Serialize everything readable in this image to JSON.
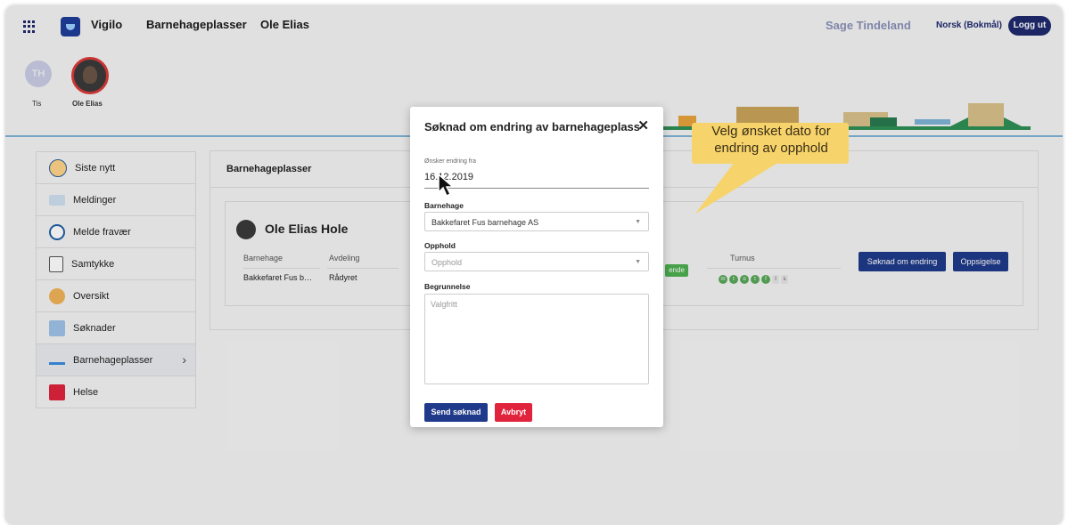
{
  "header": {
    "app_name": "Vigilo",
    "nav_items": [
      "Barnehageplasser",
      "Ole Elias"
    ],
    "user_name": "Sage Tindeland",
    "language": "Norsk (Bokmål)",
    "logout_label": "Logg ut"
  },
  "children": [
    {
      "initials": "TH",
      "label": "Tis"
    },
    {
      "initials": "",
      "label": "Ole Elias"
    }
  ],
  "sidebar": {
    "items": [
      {
        "label": "Siste nytt",
        "icon": "face-icon"
      },
      {
        "label": "Meldinger",
        "icon": "mail-icon"
      },
      {
        "label": "Melde fravær",
        "icon": "clock-icon"
      },
      {
        "label": "Samtykke",
        "icon": "form-icon"
      },
      {
        "label": "Oversikt",
        "icon": "child-icon"
      },
      {
        "label": "Søknader",
        "icon": "search-document-icon"
      },
      {
        "label": "Barnehageplasser",
        "icon": "seesaw-icon"
      },
      {
        "label": "Helse",
        "icon": "health-icon"
      }
    ]
  },
  "main": {
    "title": "Barnehageplasser",
    "child_name": "Ole Elias Hole",
    "columns": [
      "Barnehage",
      "Avdeling",
      "Turnus"
    ],
    "row": {
      "barnehage": "Bakkefaret Fus b…",
      "avdeling": "Rådyret",
      "status": "ende"
    },
    "turnus": [
      "m",
      "t",
      "o",
      "t",
      "f",
      "l",
      "s"
    ],
    "buttons": {
      "change": "Søknad om endring",
      "terminate": "Oppsigelse"
    }
  },
  "modal": {
    "title": "Søknad om endring av barnehageplass",
    "close_symbol": "✕",
    "date_label": "Ønsker endring fra",
    "date_value": "16.12.2019",
    "barnehage_label": "Barnehage",
    "barnehage_value": "Bakkefaret Fus barnehage AS",
    "opphold_label": "Opphold",
    "opphold_placeholder": "Opphold",
    "begrunnelse_label": "Begrunnelse",
    "begrunnelse_placeholder": "Valgfritt",
    "send_label": "Send søknad",
    "cancel_label": "Avbryt"
  },
  "callout": {
    "text": "Velg ønsket dato for endring av opphold"
  },
  "colors": {
    "primary": "#1f3a8a",
    "danger": "#e0243c",
    "callout": "#f7d36b"
  }
}
